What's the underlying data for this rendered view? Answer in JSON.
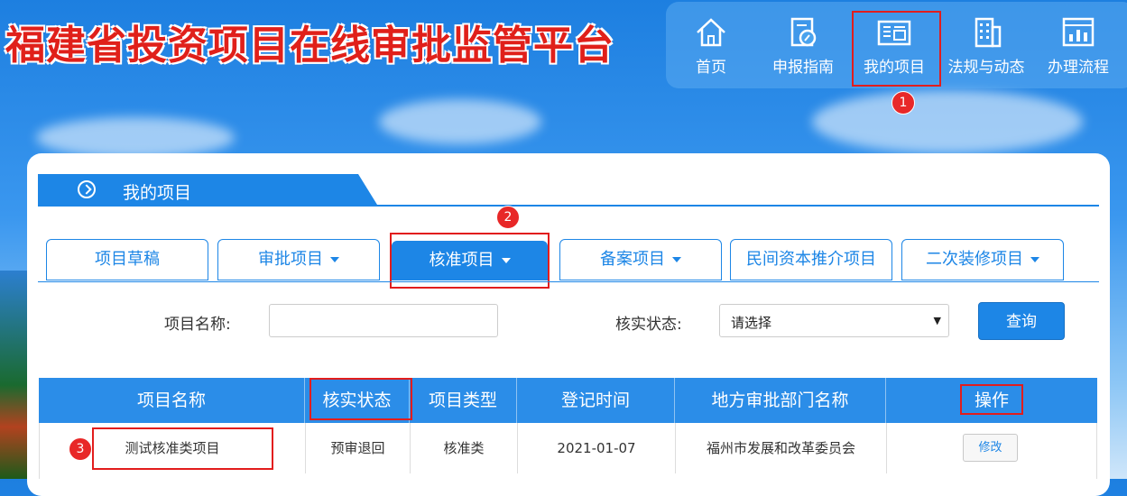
{
  "header": {
    "title": "福建省投资项目在线审批监管平台"
  },
  "nav": {
    "items": [
      {
        "label": "首页",
        "icon": "home-icon"
      },
      {
        "label": "申报指南",
        "icon": "guide-icon"
      },
      {
        "label": "我的项目",
        "icon": "project-icon"
      },
      {
        "label": "法规与动态",
        "icon": "building-icon"
      },
      {
        "label": "办理流程",
        "icon": "flow-icon"
      }
    ]
  },
  "annotations": [
    "1",
    "2",
    "3"
  ],
  "section": {
    "title": "我的项目"
  },
  "tabs": [
    {
      "label": "项目草稿",
      "dropdown": false
    },
    {
      "label": "审批项目",
      "dropdown": true
    },
    {
      "label": "核准项目",
      "dropdown": true,
      "active": true
    },
    {
      "label": "备案项目",
      "dropdown": true
    },
    {
      "label": "民间资本推介项目",
      "dropdown": false
    },
    {
      "label": "二次装修项目",
      "dropdown": true
    }
  ],
  "search": {
    "name_label": "项目名称:",
    "name_value": "",
    "status_label": "核实状态:",
    "status_value": "请选择",
    "query_label": "查询"
  },
  "table": {
    "columns": [
      "项目名称",
      "核实状态",
      "项目类型",
      "登记时间",
      "地方审批部门名称",
      "操作"
    ],
    "rows": [
      {
        "name": "测试核准类项目",
        "status": "预审退回",
        "type": "核准类",
        "date": "2021-01-07",
        "dept": "福州市发展和改革委员会",
        "action": "修改"
      }
    ]
  },
  "colors": {
    "accent": "#1d86e6",
    "title_red": "#e0201a",
    "highlight_red": "#e21d1d"
  }
}
